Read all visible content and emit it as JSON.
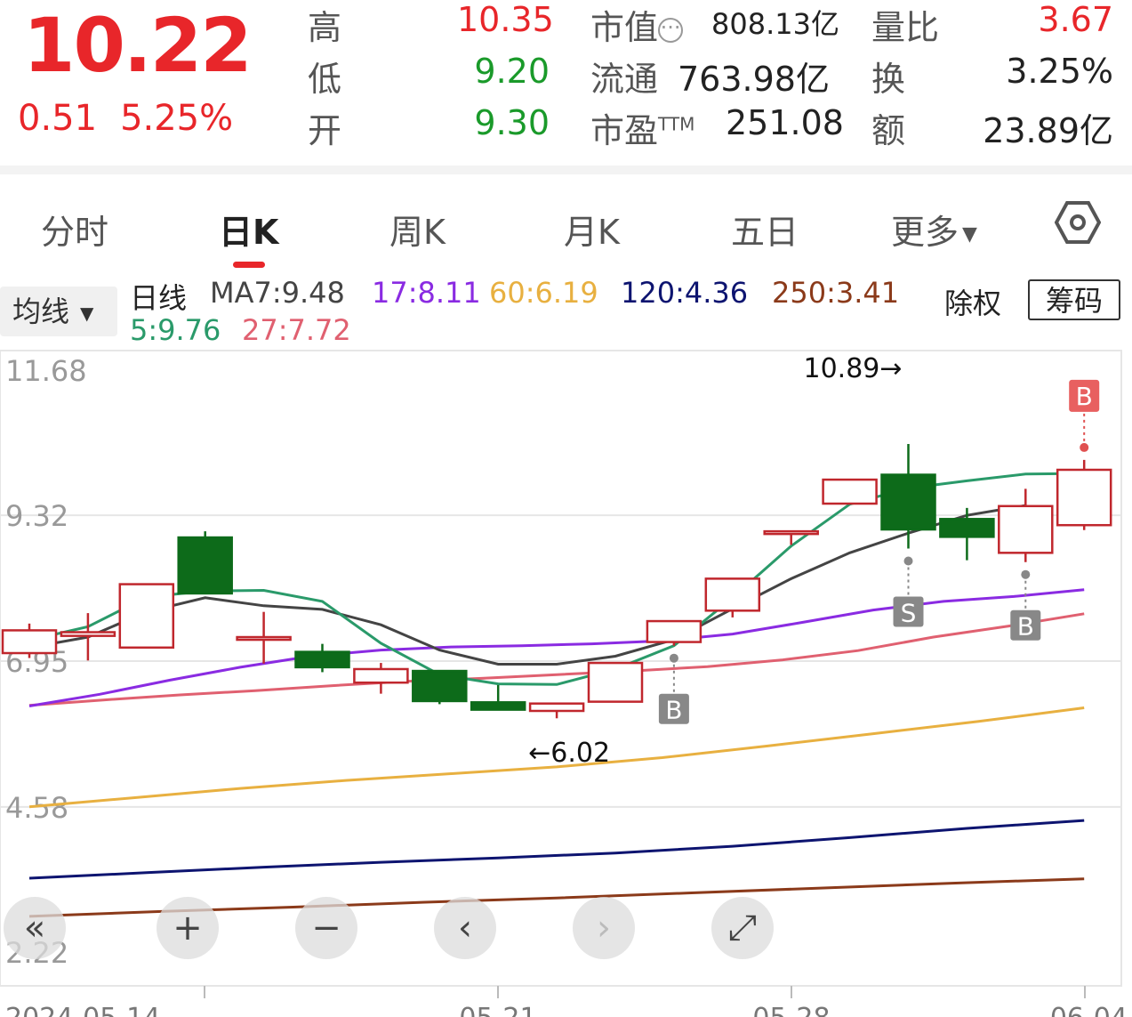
{
  "quote": {
    "price": "10.22",
    "change": "0.51",
    "change_pct": "5.25%",
    "high_label": "高",
    "high": "10.35",
    "low_label": "低",
    "low": "9.20",
    "open_label": "开",
    "open": "9.30",
    "mktcap_label": "市值",
    "mktcap": "808.13亿",
    "float_label": "流通",
    "float": "763.98亿",
    "pe_label": "市盈",
    "pe_suffix": "TTM",
    "pe": "251.08",
    "volratio_label": "量比",
    "volratio": "3.67",
    "turnover_label": "换",
    "turnover": "3.25%",
    "amount_label": "额",
    "amount": "23.89亿"
  },
  "tabs": [
    "分时",
    "日K",
    "周K",
    "月K",
    "五日",
    "更多"
  ],
  "active_tab": "日K",
  "ma_selector": "均线",
  "ma": {
    "title": "日线",
    "ma7": "MA7:9.48",
    "ma17": "17:8.11",
    "ma60": "60:6.19",
    "ma120": "120:4.36",
    "ma250": "250:3.41",
    "ma5": "5:9.76",
    "ma27": "27:7.72"
  },
  "buttons": {
    "chuquan": "除权",
    "chouma": "筹码"
  },
  "colors": {
    "up": "#c0272d",
    "down": "#0d6b1a",
    "ma7": "#444444",
    "ma17": "#8a2be2",
    "ma60": "#e8b040",
    "ma120": "#0d1470",
    "ma250": "#8b3a1a",
    "ma5": "#2a9a6a",
    "ma27": "#e06070"
  },
  "chart_data": {
    "type": "candlestick",
    "y_ticks": [
      "11.68",
      "9.32",
      "6.95",
      "4.58",
      "2.22"
    ],
    "ylim": [
      2.22,
      11.68
    ],
    "x_labels": [
      "2024-05-14",
      "05-21",
      "05-28",
      "06-04"
    ],
    "max_label": "10.89→",
    "min_label": "←6.02",
    "candles": [
      {
        "o": 7.08,
        "c": 7.45,
        "h": 7.56,
        "l": 7.0
      },
      {
        "o": 7.36,
        "c": 7.42,
        "h": 7.73,
        "l": 6.96
      },
      {
        "o": 7.17,
        "c": 8.2,
        "h": 8.2,
        "l": 7.17
      },
      {
        "o": 8.96,
        "c": 8.05,
        "h": 9.06,
        "l": 8.05
      },
      {
        "o": 7.34,
        "c": 7.34,
        "h": 7.75,
        "l": 6.91
      },
      {
        "o": 7.1,
        "c": 6.85,
        "h": 7.23,
        "l": 6.77
      },
      {
        "o": 6.6,
        "c": 6.82,
        "h": 6.92,
        "l": 6.42
      },
      {
        "o": 6.79,
        "c": 6.3,
        "h": 6.79,
        "l": 6.25
      },
      {
        "o": 6.28,
        "c": 6.16,
        "h": 6.56,
        "l": 6.16
      },
      {
        "o": 6.14,
        "c": 6.26,
        "h": 6.26,
        "l": 6.02
      },
      {
        "o": 6.29,
        "c": 6.92,
        "h": 6.92,
        "l": 6.29
      },
      {
        "o": 7.26,
        "c": 7.6,
        "h": 7.6,
        "l": 7.2
      },
      {
        "o": 7.77,
        "c": 8.29,
        "h": 8.29,
        "l": 7.66
      },
      {
        "o": 9.06,
        "c": 9.06,
        "h": 9.06,
        "l": 8.84
      },
      {
        "o": 9.51,
        "c": 9.9,
        "h": 9.9,
        "l": 9.51
      },
      {
        "o": 9.98,
        "c": 9.09,
        "h": 10.48,
        "l": 8.78
      },
      {
        "o": 9.26,
        "c": 8.97,
        "h": 9.44,
        "l": 8.59
      },
      {
        "o": 8.71,
        "c": 9.47,
        "h": 9.75,
        "l": 8.56
      },
      {
        "o": 9.16,
        "c": 10.06,
        "h": 10.22,
        "l": 9.08
      }
    ],
    "ma5": [
      7.29,
      7.51,
      7.99,
      8.09,
      8.1,
      7.92,
      7.24,
      6.73,
      6.58,
      6.57,
      6.82,
      7.2,
      7.98,
      8.82,
      9.5,
      9.76,
      9.88,
      9.99,
      10.0
    ],
    "ma7": [
      7.17,
      7.34,
      7.75,
      7.98,
      7.85,
      7.79,
      7.54,
      7.13,
      6.9,
      6.9,
      7.03,
      7.3,
      7.8,
      8.29,
      8.71,
      9.03,
      9.32,
      9.48
    ],
    "ma17": [
      6.22,
      6.41,
      6.64,
      6.85,
      7.03,
      7.13,
      7.18,
      7.2,
      7.23,
      7.28,
      7.39,
      7.58,
      7.78,
      7.92,
      8.0,
      8.11
    ],
    "ma27": [
      6.23,
      6.32,
      6.4,
      6.47,
      6.55,
      6.62,
      6.67,
      6.73,
      6.79,
      6.86,
      6.97,
      7.12,
      7.34,
      7.52,
      7.72
    ],
    "ma60": [
      4.58,
      4.73,
      4.88,
      5.01,
      5.12,
      5.23,
      5.38,
      5.57,
      5.77,
      5.97,
      6.19
    ],
    "ma120": [
      3.42,
      3.51,
      3.6,
      3.68,
      3.75,
      3.83,
      3.94,
      4.08,
      4.23,
      4.36
    ],
    "ma250": [
      2.8,
      2.88,
      2.95,
      3.03,
      3.1,
      3.18,
      3.26,
      3.34,
      3.41
    ],
    "markers": [
      {
        "index": 11,
        "label": "B",
        "pos": "below"
      },
      {
        "index": 15,
        "label": "S",
        "pos": "below"
      },
      {
        "index": 17,
        "label": "B",
        "pos": "below"
      },
      {
        "index": 18,
        "label": "B",
        "pos": "above"
      }
    ]
  }
}
